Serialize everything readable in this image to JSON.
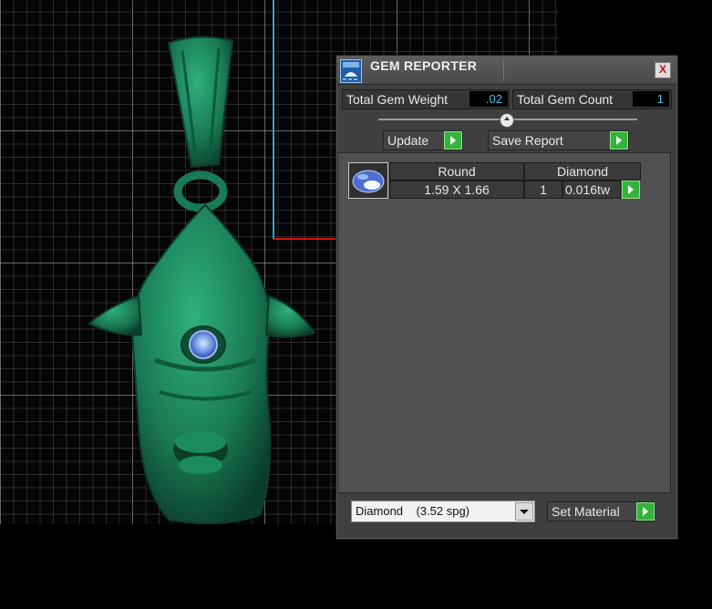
{
  "panel": {
    "title": "GEM REPORTER",
    "close_label": "X",
    "total_weight_label": "Total Gem Weight",
    "total_weight_value": ".02",
    "total_count_label": "Total Gem Count",
    "total_count_value": "1",
    "update_label": "Update",
    "save_report_label": "Save Report",
    "set_material_label": "Set Material",
    "material_select_value": "Diamond    (3.52 spg)"
  },
  "gems": [
    {
      "shape": "Round",
      "material": "Diamond",
      "size": "1.59 X 1.66",
      "count": "1",
      "weight": "0.016tw"
    }
  ],
  "colors": {
    "model": "#1f8a62",
    "value_text": "#43c3e6",
    "go_button": "#32b43a",
    "axis_x": "#d01818",
    "axis_y": "#2aa7c4"
  },
  "icons": {
    "title": "gem-reporter-icon",
    "close": "close-icon",
    "gem_thumb": "round-gem-icon",
    "go": "play-arrow-icon",
    "slider": "chevron-up-icon",
    "dropdown": "chevron-down-icon"
  }
}
